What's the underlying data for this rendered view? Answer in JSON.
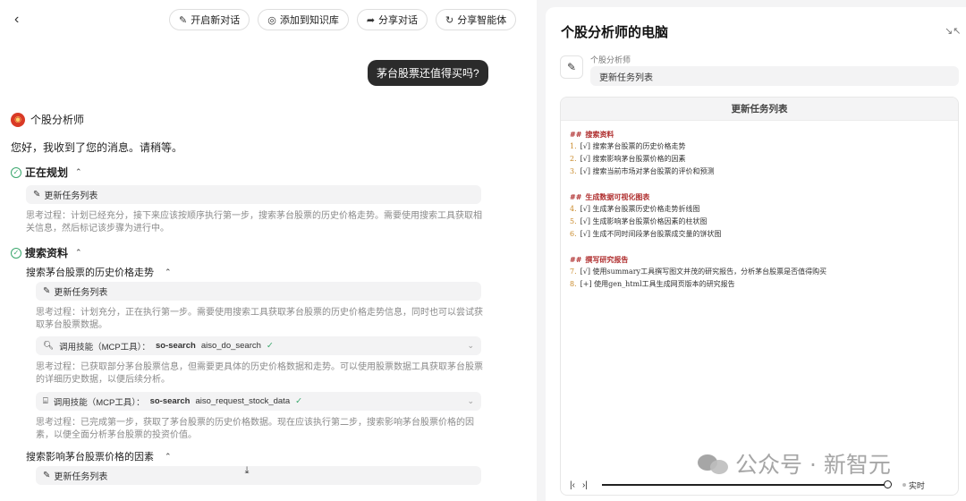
{
  "toolbar": {
    "new_chat": "开启新对话",
    "add_kb": "添加到知识库",
    "share_chat": "分享对话",
    "share_agent": "分享智能体"
  },
  "chat": {
    "user_message": "茅台股票还值得买吗?",
    "agent_name": "个股分析师",
    "greeting": "您好，我收到了您的消息。请稍等。",
    "planning": {
      "title": "正在规划",
      "chip": "更新任务列表",
      "thought": "思考过程：计划已经充分，接下来应该按顺序执行第一步，搜索茅台股票的历史价格走势。需要使用搜索工具获取相关信息，然后标记该步骤为进行中。"
    },
    "search": {
      "title": "搜索资料",
      "sub1": {
        "title": "搜索茅台股票的历史价格走势",
        "chip": "更新任务列表",
        "thought1": "思考过程：计划充分，正在执行第一步。需要使用搜索工具获取茅台股票的历史价格走势信息，同时也可以尝试获取茅台股票数据。",
        "tool1": {
          "label": "调用技能（MCP工具）：",
          "server": "so-search",
          "name": "aiso_do_search"
        },
        "thought2": "思考过程：已获取部分茅台股票信息，但需要更具体的历史价格数据和走势。可以使用股票数据工具获取茅台股票的详细历史数据，以便后续分析。",
        "tool2": {
          "label": "调用技能（MCP工具）：",
          "server": "so-search",
          "name": "aiso_request_stock_data"
        },
        "thought3": "思考过程：已完成第一步，获取了茅台股票的历史价格数据。现在应该执行第二步，搜索影响茅台股票价格的因素，以便全面分析茅台股票的投资价值。"
      },
      "sub2": {
        "title": "搜索影响茅台股票价格的因素",
        "chip": "更新任务列表"
      }
    }
  },
  "computer": {
    "title": "个股分析师的电脑",
    "role": "个股分析师",
    "action": "更新任务列表",
    "card_title": "更新任务列表",
    "sections": [
      {
        "heading": "搜索资料",
        "items": [
          {
            "num": "1.",
            "text": "[√] 搜索茅台股票的历史价格走势"
          },
          {
            "num": "2.",
            "text": "[√] 搜索影响茅台股票价格的因素"
          },
          {
            "num": "3.",
            "text": "[√] 搜索当前市场对茅台股票的评价和预测"
          }
        ]
      },
      {
        "heading": "生成数据可视化图表",
        "items": [
          {
            "num": "4.",
            "text": "[√] 生成茅台股票历史价格走势折线图"
          },
          {
            "num": "5.",
            "text": "[√] 生成影响茅台股票价格因素的柱状图"
          },
          {
            "num": "6.",
            "text": "[√] 生成不同时间段茅台股票成交量的饼状图"
          }
        ]
      },
      {
        "heading": "撰写研究报告",
        "items": [
          {
            "num": "7.",
            "text": "[√] 使用summary工具撰写图文并茂的研究报告，分析茅台股票是否值得购买"
          },
          {
            "num": "8.",
            "text": "[+] 使用gen_html工具生成网页版本的研究报告"
          }
        ]
      }
    ],
    "hash": "##",
    "live": "实时"
  },
  "watermark": "公众号 · 新智元"
}
